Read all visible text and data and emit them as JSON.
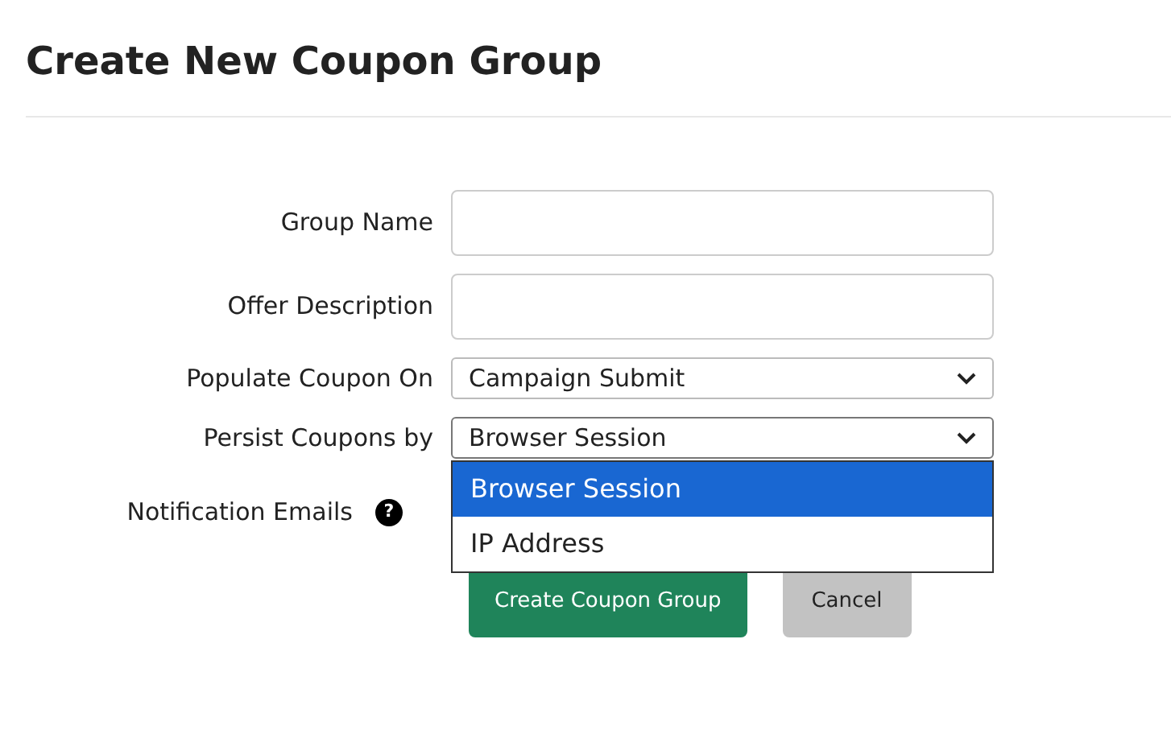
{
  "title": "Create New Coupon Group",
  "fields": [
    {
      "label": "Group Name",
      "kind": "text"
    },
    {
      "label": "Offer Description",
      "kind": "text"
    },
    {
      "label": "Populate Coupon On",
      "kind": "select",
      "value": "Campaign Submit",
      "expanded": false
    },
    {
      "label": "Persist Coupons by",
      "kind": "select",
      "value": "Browser Session",
      "expanded": true,
      "options": [
        {
          "label": "Browser Session",
          "selected": true
        },
        {
          "label": "IP Address",
          "selected": false
        }
      ]
    },
    {
      "label": "Notification Emails",
      "kind": "hidden",
      "help_icon": "?"
    }
  ],
  "buttons": [
    {
      "label": "Create Coupon Group",
      "kind": "primary"
    },
    {
      "label": "Cancel",
      "kind": "secondary"
    }
  ]
}
